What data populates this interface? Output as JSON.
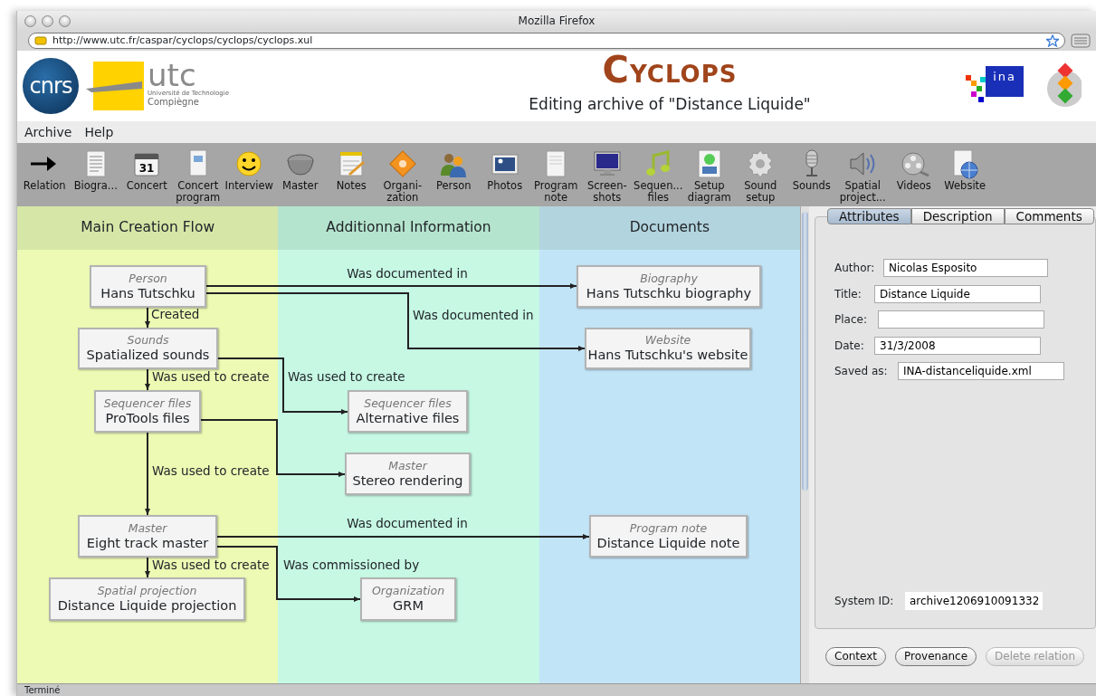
{
  "window": {
    "title": "Mozilla Firefox"
  },
  "address_bar": {
    "url": "http://www.utc.fr/caspar/cyclops/cyclops/cyclops.xul"
  },
  "banner": {
    "left_logos": [
      {
        "kind": "cnrs",
        "text": "cnrs"
      },
      {
        "kind": "utc",
        "text": "utc",
        "subtitle": "Université de Technologie",
        "subtitle2": "Compiègne"
      }
    ],
    "app_name_initial": "C",
    "app_name_rest": "YCLOPS",
    "subtitle": "Editing archive of \"Distance Liquide\"",
    "right_logos": [
      {
        "kind": "ina",
        "text": "ina"
      },
      {
        "kind": "caspar"
      }
    ]
  },
  "menu": [
    "Archive",
    "Help"
  ],
  "toolbar": [
    {
      "label": "Relation"
    },
    {
      "label": "Biogra..."
    },
    {
      "label": "Concert",
      "icon_text": "31"
    },
    {
      "label": "Concert program"
    },
    {
      "label": "Interview"
    },
    {
      "label": "Master"
    },
    {
      "label": "Notes"
    },
    {
      "label": "Organi-\nzation"
    },
    {
      "label": "Person"
    },
    {
      "label": "Photos"
    },
    {
      "label": "Program note"
    },
    {
      "label": "Screen-\nshots"
    },
    {
      "label": "Sequen...\nfiles"
    },
    {
      "label": "Setup diagram"
    },
    {
      "label": "Sound setup"
    },
    {
      "label": "Sounds"
    },
    {
      "label": "Spatial project..."
    },
    {
      "label": "Videos"
    },
    {
      "label": "Website"
    }
  ],
  "diagram": {
    "columns": [
      {
        "title": "Main Creation Flow",
        "color": "#ecfab4"
      },
      {
        "title": "Additionnal Information",
        "color": "#c6f8e4"
      },
      {
        "title": "Documents",
        "color": "#c2e4f7"
      }
    ],
    "nodes": [
      {
        "type": "Person",
        "name": "Hans Tutschku"
      },
      {
        "type": "Sounds",
        "name": "Spatialized sounds"
      },
      {
        "type": "Sequencer files",
        "name": "ProTools files"
      },
      {
        "type": "Master",
        "name": "Eight track master"
      },
      {
        "type": "Spatial projection",
        "name": "Distance Liquide projection"
      },
      {
        "type": "Sequencer files",
        "name": "Alternative files"
      },
      {
        "type": "Master",
        "name": "Stereo rendering"
      },
      {
        "type": "Organization",
        "name": "GRM"
      },
      {
        "type": "Biography",
        "name": "Hans Tutschku biography"
      },
      {
        "type": "Website",
        "name": "Hans Tutschku's website"
      },
      {
        "type": "Program note",
        "name": "Distance Liquide note"
      }
    ],
    "edges": [
      {
        "kind": "arrow",
        "label": "Created"
      },
      {
        "kind": "arrow",
        "label": "Was used to create"
      },
      {
        "kind": "arrow",
        "label": "Was used to create"
      },
      {
        "kind": "arrow",
        "label": "Was used to create"
      },
      {
        "kind": "arrow",
        "label": "Was documented in"
      },
      {
        "kind": "arrow",
        "label": "Was documented in"
      },
      {
        "kind": "arrow",
        "label": "Was used to create"
      },
      {
        "kind": "arrow"
      },
      {
        "kind": "arrow",
        "label": "Was documented in"
      },
      {
        "kind": "arrow",
        "label": "Was commissioned by"
      }
    ]
  },
  "details": {
    "tabs": [
      {
        "label": "Attributes",
        "selected": true
      },
      {
        "label": "Description",
        "selected": false
      },
      {
        "label": "Comments",
        "selected": false
      }
    ],
    "fields": [
      {
        "label": "Author:",
        "value": "Nicolas Esposito"
      },
      {
        "label": "Title:",
        "value": "Distance Liquide"
      },
      {
        "label": "Place:"
      },
      {
        "label": "Date:",
        "value": "31/3/2008"
      },
      {
        "label": "Saved as:",
        "value": "INA-distanceliquide.xml"
      }
    ],
    "system_id": {
      "label": "System ID:",
      "value": "archive1206910091332"
    },
    "buttons": [
      {
        "label": "Context",
        "disabled": false
      },
      {
        "label": "Provenance",
        "disabled": false
      },
      {
        "label": "Delete relation",
        "disabled": true
      }
    ]
  },
  "status_bar": {
    "text": "Terminé"
  }
}
